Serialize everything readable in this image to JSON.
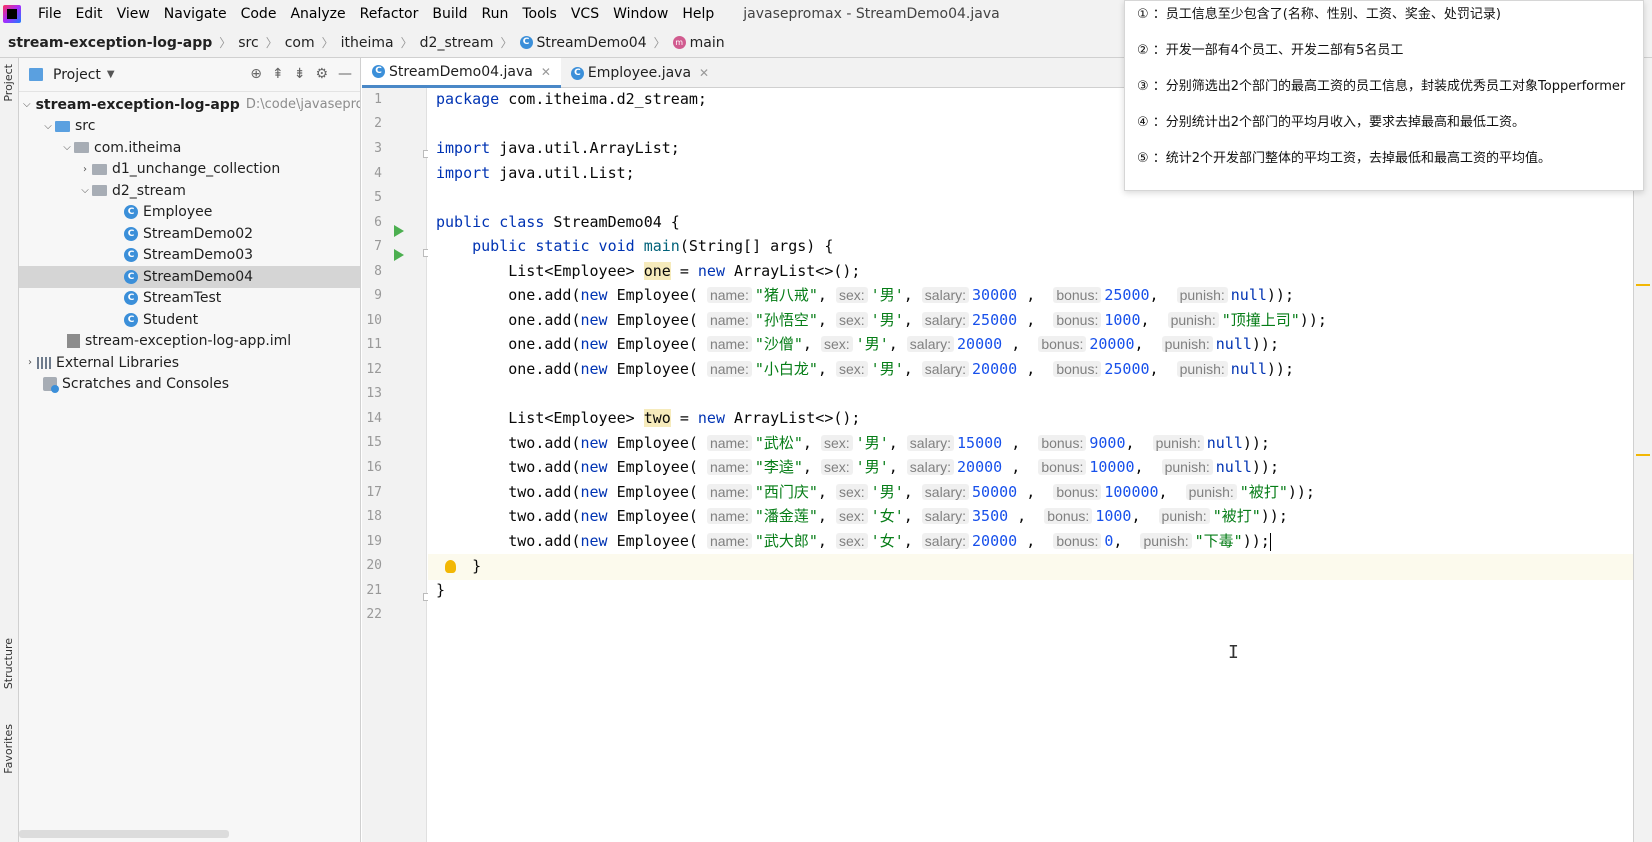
{
  "menubar": {
    "items": [
      "File",
      "Edit",
      "View",
      "Navigate",
      "Code",
      "Analyze",
      "Refactor",
      "Build",
      "Run",
      "Tools",
      "VCS",
      "Window",
      "Help"
    ],
    "window_title": "javasepromax - StreamDemo04.java"
  },
  "breadcrumb": [
    "stream-exception-log-app",
    "src",
    "com",
    "itheima",
    "d2_stream",
    "StreamDemo04",
    "main"
  ],
  "project_panel": {
    "title": "Project",
    "tree": {
      "root": "stream-exception-log-app",
      "root_path": "D:\\code\\javasepro",
      "src": "src",
      "pkg": "com.itheima",
      "d1": "d1_unchange_collection",
      "d2": "d2_stream",
      "files": [
        "Employee",
        "StreamDemo02",
        "StreamDemo03",
        "StreamDemo04",
        "StreamTest",
        "Student"
      ],
      "iml": "stream-exception-log-app.iml",
      "ext_libs": "External Libraries",
      "scratches": "Scratches and Consoles"
    }
  },
  "left_strip": {
    "project": "Project",
    "structure": "Structure",
    "favorites": "Favorites"
  },
  "tabs": [
    "StreamDemo04.java",
    "Employee.java"
  ],
  "code": {
    "l1_kw": "package",
    "l1": " com.itheima.d2_stream;",
    "l3_kw": "import",
    "l3": " java.util.ArrayList;",
    "l4_kw": "import",
    "l4": " java.util.List;",
    "l6_kw": "public class",
    "l6": " StreamDemo04 {",
    "l7_kw": "public static void",
    "l7_fn": "main",
    "l7": "(String[] args) {",
    "l8_a": "List<Employee> ",
    "l8_var": "one",
    "l8_b": " = ",
    "l8_kw": "new",
    "l8_c": " ArrayList<>();",
    "l14_a": "List<Employee> ",
    "l14_var": "two",
    "l14_b": " = ",
    "l14_kw": "new",
    "l14_c": " ArrayList<>();",
    "l20": "}",
    "l21": "}",
    "one_var": "one",
    "two_var": "two",
    "add_prefix": ".add(",
    "new_kw": "new",
    "ctor": " Employee(",
    "hint_name": "name:",
    "hint_sex": "sex:",
    "hint_salary": "salary:",
    "hint_bonus": "bonus:",
    "hint_punish": "punish:",
    "null_kw": "null",
    "end_stmt": "));",
    "one_rows": [
      {
        "name": "\"猪八戒\"",
        "sex": "'男'",
        "salary": "30000",
        "bonus": "25000",
        "punish": "null"
      },
      {
        "name": "\"孙悟空\"",
        "sex": "'男'",
        "salary": "25000",
        "bonus": "1000",
        "punish": "\"顶撞上司\""
      },
      {
        "name": "\"沙僧\"",
        "sex": "'男'",
        "salary": "20000",
        "bonus": "20000",
        "punish": "null"
      },
      {
        "name": "\"小白龙\"",
        "sex": "'男'",
        "salary": "20000",
        "bonus": "25000",
        "punish": "null"
      }
    ],
    "two_rows": [
      {
        "name": "\"武松\"",
        "sex": "'男'",
        "salary": "15000",
        "bonus": "9000",
        "punish": "null"
      },
      {
        "name": "\"李逵\"",
        "sex": "'男'",
        "salary": "20000",
        "bonus": "10000",
        "punish": "null"
      },
      {
        "name": "\"西门庆\"",
        "sex": "'男'",
        "salary": "50000",
        "bonus": "100000",
        "punish": "\"被打\""
      },
      {
        "name": "\"潘金莲\"",
        "sex": "'女'",
        "salary": "3500",
        "bonus": "1000",
        "punish": "\"被打\""
      },
      {
        "name": "\"武大郎\"",
        "sex": "'女'",
        "salary": "20000",
        "bonus": "0",
        "punish": "\"下毒\""
      }
    ]
  },
  "line_numbers": [
    "1",
    "2",
    "3",
    "4",
    "5",
    "6",
    "7",
    "8",
    "9",
    "10",
    "11",
    "12",
    "13",
    "14",
    "15",
    "16",
    "17",
    "18",
    "19",
    "20",
    "21",
    "22"
  ],
  "notes": [
    "① ：员工信息至少包含了(名称、性别、工资、奖金、处罚记录)",
    "② ：开发一部有4个员工、开发二部有5名员工",
    "③ ：分别筛选出2个部门的最高工资的员工信息，封装成优秀员工对象Topperformer",
    "④ ：分别统计出2个部门的平均月收入，要求去掉最高和最低工资。",
    "⑤ ：统计2个开发部门整体的平均工资，去掉最低和最高工资的平均值。"
  ]
}
